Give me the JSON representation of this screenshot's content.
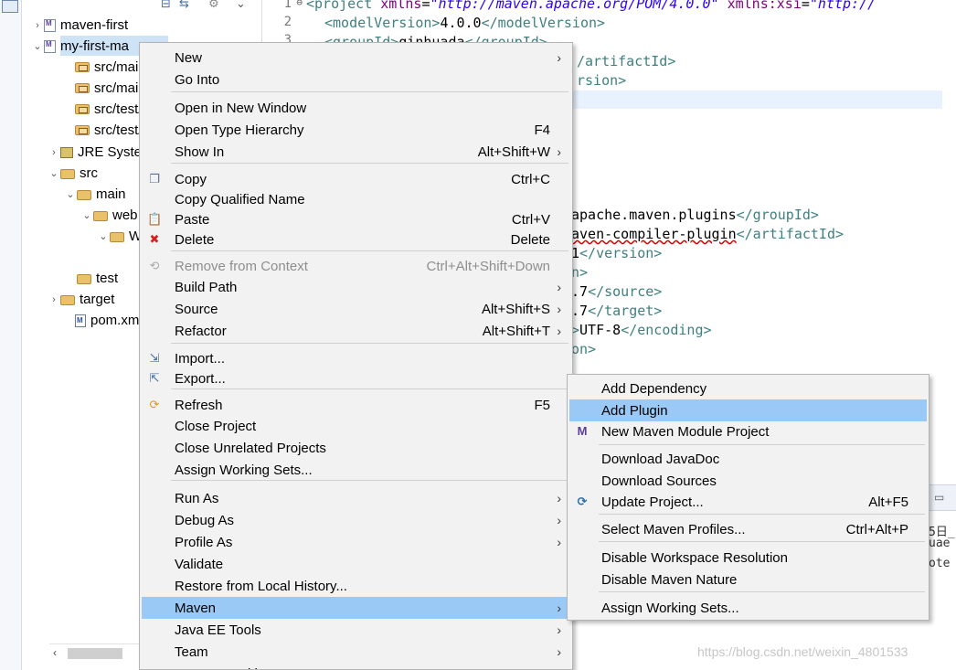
{
  "explorer": {
    "tree": [
      {
        "label": "maven-first",
        "kind": "project",
        "twisty": "›"
      },
      {
        "label": "my-first-ma",
        "kind": "project",
        "twisty": "⌄"
      },
      {
        "label": "src/main/",
        "kind": "pkgfolder"
      },
      {
        "label": "src/main/",
        "kind": "pkgfolder"
      },
      {
        "label": "src/test/j",
        "kind": "pkgfolder"
      },
      {
        "label": "src/test/r",
        "kind": "pkgfolder"
      },
      {
        "label": "JRE Syste",
        "kind": "jre",
        "twisty": "›"
      },
      {
        "label": "src",
        "kind": "folder",
        "twisty": "⌄"
      },
      {
        "label": "main",
        "kind": "folder",
        "twisty": "⌄"
      },
      {
        "label": "web",
        "kind": "folder",
        "twisty": "⌄"
      },
      {
        "label": "W",
        "kind": "folder",
        "twisty": "⌄"
      },
      {
        "label": "",
        "kind": "file"
      },
      {
        "label": "test",
        "kind": "folder"
      },
      {
        "label": "target",
        "kind": "folder",
        "twisty": "›"
      },
      {
        "label": "pom.xml",
        "kind": "pom"
      }
    ]
  },
  "editor": {
    "line_numbers": [
      "1",
      "2",
      "3"
    ],
    "lines": {
      "l1_open": "<project ",
      "l1_attr1": "xmlns",
      "l1_eq": "=",
      "l1_val1": "\"http://maven.apache.org/POM/4.0.0\"",
      "l1_attr2": " xmlns:xsi",
      "l1_eq2": "=",
      "l1_val2": "\"http://",
      "l2_open": "<modelVersion>",
      "l2_text": "4.0.0",
      "l2_close": "</modelVersion>",
      "l3_open": "<groupId>",
      "l3_text": "qinhuada",
      "l3_close": "</groupId>",
      "l4": "/artifactId>",
      "l5": "rsion>",
      "l6_text": "apache.maven.plugins",
      "l6_close": "</groupId>",
      "l7_text": "aven-compiler-plugin",
      "l7_close": "</artifactId>",
      "l8_text": "1",
      "l8_close": "</version>",
      "l9": "n>",
      "l10_text": ".7",
      "l10_close": "</source>",
      "l11_text": ".7",
      "l11_close": "</target>",
      "l12_open": ">",
      "l12_text": "UTF-8",
      "l12_close": "</encoding>",
      "l13": "on>"
    }
  },
  "console": {
    "line1": "5日_",
    "line2": "uae",
    "line3": "ote"
  },
  "watermark": "https://blog.csdn.net/weixin_4801533",
  "context_menu": {
    "items": [
      {
        "label": "New",
        "accel": "",
        "submenu": true
      },
      {
        "label": "Go Into",
        "accel": ""
      },
      {
        "label": "Open in New Window",
        "accel": ""
      },
      {
        "label": "Open Type Hierarchy",
        "accel": "F4"
      },
      {
        "label": "Show In",
        "accel": "Alt+Shift+W",
        "submenu": true
      },
      {
        "label": "Copy",
        "accel": "Ctrl+C",
        "icon": "copy-icon"
      },
      {
        "label": "Copy Qualified Name",
        "accel": "",
        "icon": "copy-qualified-icon"
      },
      {
        "label": "Paste",
        "accel": "Ctrl+V",
        "icon": "paste-icon"
      },
      {
        "label": "Delete",
        "accel": "Delete",
        "icon": "delete-icon"
      },
      {
        "label": "Remove from Context",
        "accel": "Ctrl+Alt+Shift+Down",
        "disabled": true,
        "icon": "remove-context-icon"
      },
      {
        "label": "Build Path",
        "accel": "",
        "submenu": true
      },
      {
        "label": "Source",
        "accel": "Alt+Shift+S",
        "submenu": true
      },
      {
        "label": "Refactor",
        "accel": "Alt+Shift+T",
        "submenu": true
      },
      {
        "label": "Import...",
        "accel": "",
        "icon": "import-icon"
      },
      {
        "label": "Export...",
        "accel": "",
        "icon": "export-icon"
      },
      {
        "label": "Refresh",
        "accel": "F5",
        "icon": "refresh-icon"
      },
      {
        "label": "Close Project",
        "accel": ""
      },
      {
        "label": "Close Unrelated Projects",
        "accel": ""
      },
      {
        "label": "Assign Working Sets...",
        "accel": ""
      },
      {
        "label": "Run As",
        "accel": "",
        "submenu": true
      },
      {
        "label": "Debug As",
        "accel": "",
        "submenu": true
      },
      {
        "label": "Profile As",
        "accel": "",
        "submenu": true
      },
      {
        "label": "Validate",
        "accel": ""
      },
      {
        "label": "Restore from Local History...",
        "accel": ""
      },
      {
        "label": "Maven",
        "accel": "",
        "submenu": true,
        "highlighted": true
      },
      {
        "label": "Java EE Tools",
        "accel": "",
        "submenu": true
      },
      {
        "label": "Team",
        "accel": "",
        "submenu": true
      },
      {
        "label": "Compare With",
        "accel": "",
        "submenu": true
      }
    ]
  },
  "maven_submenu": {
    "items": [
      {
        "label": "Add Dependency",
        "accel": ""
      },
      {
        "label": "Add Plugin",
        "accel": "",
        "highlighted": true
      },
      {
        "label": "New Maven Module Project",
        "accel": "",
        "icon": "maven-module-icon"
      },
      {
        "label": "Download JavaDoc",
        "accel": ""
      },
      {
        "label": "Download Sources",
        "accel": ""
      },
      {
        "label": "Update Project...",
        "accel": "Alt+F5",
        "icon": "update-project-icon"
      },
      {
        "label": "Select Maven Profiles...",
        "accel": "Ctrl+Alt+P"
      },
      {
        "label": "Disable Workspace Resolution",
        "accel": ""
      },
      {
        "label": "Disable Maven Nature",
        "accel": ""
      },
      {
        "label": "Assign Working Sets...",
        "accel": ""
      }
    ]
  },
  "colors": {
    "highlight": "#99c9f4",
    "menu_bg": "#f2f2f2",
    "xml_tag": "#3f7f7f",
    "xml_attr": "#7f007f",
    "xml_string": "#2a00ff"
  }
}
